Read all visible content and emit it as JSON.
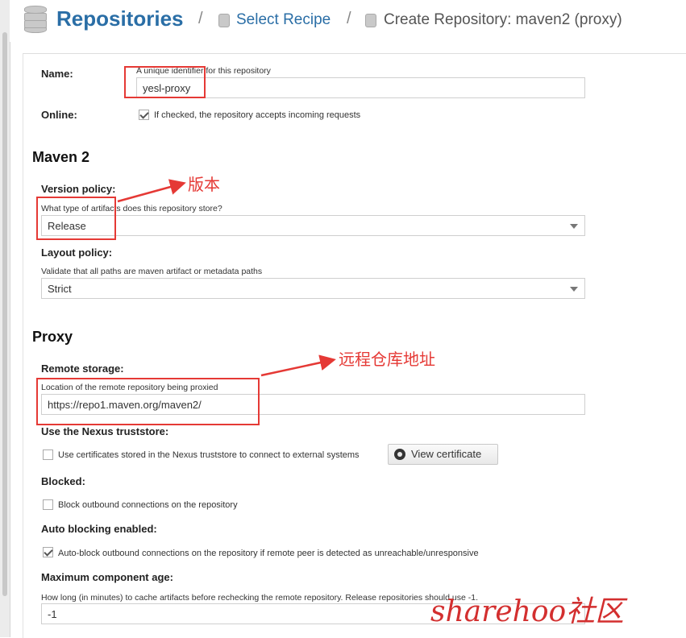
{
  "header": {
    "title": "Repositories",
    "separator": "/",
    "crumb_select": "Select Recipe",
    "crumb_current": "Create Repository: maven2 (proxy)"
  },
  "form": {
    "name_label": "Name:",
    "name_help": "A unique identifier for this repository",
    "name_value": "yesl-proxy",
    "online_label": "Online:",
    "online_text": "If checked, the repository accepts incoming requests",
    "online_checked": true,
    "maven_section": "Maven 2",
    "version_label": "Version policy:",
    "version_help": "What type of artifacts does this repository store?",
    "version_value": "Release",
    "layout_label": "Layout policy:",
    "layout_help": "Validate that all paths are maven artifact or metadata paths",
    "layout_value": "Strict",
    "proxy_section": "Proxy",
    "remote_label": "Remote storage:",
    "remote_help": "Location of the remote repository being proxied",
    "remote_value": "https://repo1.maven.org/maven2/",
    "truststore_label": "Use the Nexus truststore:",
    "truststore_text": "Use certificates stored in the Nexus truststore to connect to external systems",
    "truststore_checked": false,
    "view_cert_button": "View certificate",
    "blocked_label": "Blocked:",
    "blocked_text": "Block outbound connections on the repository",
    "blocked_checked": false,
    "autoblock_label": "Auto blocking enabled:",
    "autoblock_text": "Auto-block outbound connections on the repository if remote peer is detected as unreachable/unresponsive",
    "autoblock_checked": true,
    "maxage_label": "Maximum component age:",
    "maxage_help": "How long (in minutes) to cache artifacts before rechecking the remote repository. Release repositories should use -1.",
    "maxage_value": "-1"
  },
  "annotations": {
    "version_note": "版本",
    "remote_note": "远程仓库地址",
    "color": "#e53935"
  },
  "watermark": "sharehoo社区"
}
